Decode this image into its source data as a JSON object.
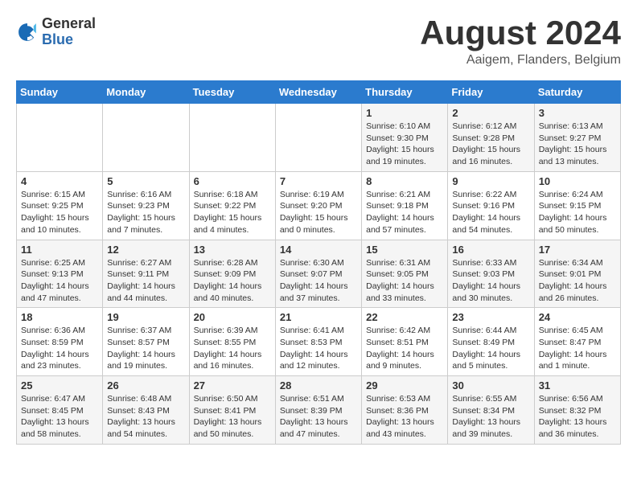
{
  "header": {
    "logo_general": "General",
    "logo_blue": "Blue",
    "month_title": "August 2024",
    "location": "Aaigem, Flanders, Belgium"
  },
  "weekdays": [
    "Sunday",
    "Monday",
    "Tuesday",
    "Wednesday",
    "Thursday",
    "Friday",
    "Saturday"
  ],
  "weeks": [
    [
      {
        "day": "",
        "info": ""
      },
      {
        "day": "",
        "info": ""
      },
      {
        "day": "",
        "info": ""
      },
      {
        "day": "",
        "info": ""
      },
      {
        "day": "1",
        "sunrise": "Sunrise: 6:10 AM",
        "sunset": "Sunset: 9:30 PM",
        "daylight": "Daylight: 15 hours and 19 minutes."
      },
      {
        "day": "2",
        "sunrise": "Sunrise: 6:12 AM",
        "sunset": "Sunset: 9:28 PM",
        "daylight": "Daylight: 15 hours and 16 minutes."
      },
      {
        "day": "3",
        "sunrise": "Sunrise: 6:13 AM",
        "sunset": "Sunset: 9:27 PM",
        "daylight": "Daylight: 15 hours and 13 minutes."
      }
    ],
    [
      {
        "day": "4",
        "sunrise": "Sunrise: 6:15 AM",
        "sunset": "Sunset: 9:25 PM",
        "daylight": "Daylight: 15 hours and 10 minutes."
      },
      {
        "day": "5",
        "sunrise": "Sunrise: 6:16 AM",
        "sunset": "Sunset: 9:23 PM",
        "daylight": "Daylight: 15 hours and 7 minutes."
      },
      {
        "day": "6",
        "sunrise": "Sunrise: 6:18 AM",
        "sunset": "Sunset: 9:22 PM",
        "daylight": "Daylight: 15 hours and 4 minutes."
      },
      {
        "day": "7",
        "sunrise": "Sunrise: 6:19 AM",
        "sunset": "Sunset: 9:20 PM",
        "daylight": "Daylight: 15 hours and 0 minutes."
      },
      {
        "day": "8",
        "sunrise": "Sunrise: 6:21 AM",
        "sunset": "Sunset: 9:18 PM",
        "daylight": "Daylight: 14 hours and 57 minutes."
      },
      {
        "day": "9",
        "sunrise": "Sunrise: 6:22 AM",
        "sunset": "Sunset: 9:16 PM",
        "daylight": "Daylight: 14 hours and 54 minutes."
      },
      {
        "day": "10",
        "sunrise": "Sunrise: 6:24 AM",
        "sunset": "Sunset: 9:15 PM",
        "daylight": "Daylight: 14 hours and 50 minutes."
      }
    ],
    [
      {
        "day": "11",
        "sunrise": "Sunrise: 6:25 AM",
        "sunset": "Sunset: 9:13 PM",
        "daylight": "Daylight: 14 hours and 47 minutes."
      },
      {
        "day": "12",
        "sunrise": "Sunrise: 6:27 AM",
        "sunset": "Sunset: 9:11 PM",
        "daylight": "Daylight: 14 hours and 44 minutes."
      },
      {
        "day": "13",
        "sunrise": "Sunrise: 6:28 AM",
        "sunset": "Sunset: 9:09 PM",
        "daylight": "Daylight: 14 hours and 40 minutes."
      },
      {
        "day": "14",
        "sunrise": "Sunrise: 6:30 AM",
        "sunset": "Sunset: 9:07 PM",
        "daylight": "Daylight: 14 hours and 37 minutes."
      },
      {
        "day": "15",
        "sunrise": "Sunrise: 6:31 AM",
        "sunset": "Sunset: 9:05 PM",
        "daylight": "Daylight: 14 hours and 33 minutes."
      },
      {
        "day": "16",
        "sunrise": "Sunrise: 6:33 AM",
        "sunset": "Sunset: 9:03 PM",
        "daylight": "Daylight: 14 hours and 30 minutes."
      },
      {
        "day": "17",
        "sunrise": "Sunrise: 6:34 AM",
        "sunset": "Sunset: 9:01 PM",
        "daylight": "Daylight: 14 hours and 26 minutes."
      }
    ],
    [
      {
        "day": "18",
        "sunrise": "Sunrise: 6:36 AM",
        "sunset": "Sunset: 8:59 PM",
        "daylight": "Daylight: 14 hours and 23 minutes."
      },
      {
        "day": "19",
        "sunrise": "Sunrise: 6:37 AM",
        "sunset": "Sunset: 8:57 PM",
        "daylight": "Daylight: 14 hours and 19 minutes."
      },
      {
        "day": "20",
        "sunrise": "Sunrise: 6:39 AM",
        "sunset": "Sunset: 8:55 PM",
        "daylight": "Daylight: 14 hours and 16 minutes."
      },
      {
        "day": "21",
        "sunrise": "Sunrise: 6:41 AM",
        "sunset": "Sunset: 8:53 PM",
        "daylight": "Daylight: 14 hours and 12 minutes."
      },
      {
        "day": "22",
        "sunrise": "Sunrise: 6:42 AM",
        "sunset": "Sunset: 8:51 PM",
        "daylight": "Daylight: 14 hours and 9 minutes."
      },
      {
        "day": "23",
        "sunrise": "Sunrise: 6:44 AM",
        "sunset": "Sunset: 8:49 PM",
        "daylight": "Daylight: 14 hours and 5 minutes."
      },
      {
        "day": "24",
        "sunrise": "Sunrise: 6:45 AM",
        "sunset": "Sunset: 8:47 PM",
        "daylight": "Daylight: 14 hours and 1 minute."
      }
    ],
    [
      {
        "day": "25",
        "sunrise": "Sunrise: 6:47 AM",
        "sunset": "Sunset: 8:45 PM",
        "daylight": "Daylight: 13 hours and 58 minutes."
      },
      {
        "day": "26",
        "sunrise": "Sunrise: 6:48 AM",
        "sunset": "Sunset: 8:43 PM",
        "daylight": "Daylight: 13 hours and 54 minutes."
      },
      {
        "day": "27",
        "sunrise": "Sunrise: 6:50 AM",
        "sunset": "Sunset: 8:41 PM",
        "daylight": "Daylight: 13 hours and 50 minutes."
      },
      {
        "day": "28",
        "sunrise": "Sunrise: 6:51 AM",
        "sunset": "Sunset: 8:39 PM",
        "daylight": "Daylight: 13 hours and 47 minutes."
      },
      {
        "day": "29",
        "sunrise": "Sunrise: 6:53 AM",
        "sunset": "Sunset: 8:36 PM",
        "daylight": "Daylight: 13 hours and 43 minutes."
      },
      {
        "day": "30",
        "sunrise": "Sunrise: 6:55 AM",
        "sunset": "Sunset: 8:34 PM",
        "daylight": "Daylight: 13 hours and 39 minutes."
      },
      {
        "day": "31",
        "sunrise": "Sunrise: 6:56 AM",
        "sunset": "Sunset: 8:32 PM",
        "daylight": "Daylight: 13 hours and 36 minutes."
      }
    ]
  ]
}
